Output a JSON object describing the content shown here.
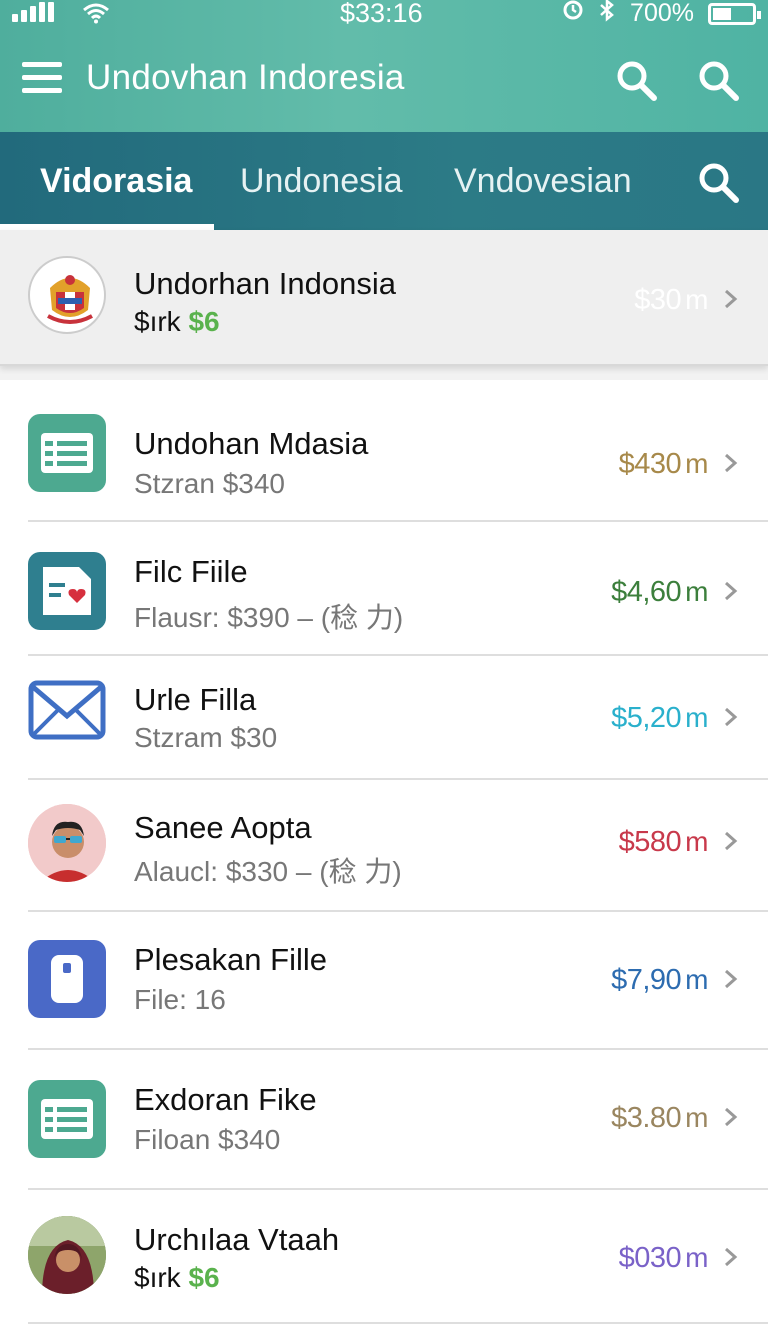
{
  "status_bar": {
    "time": "$33:16",
    "battery": "700%",
    "icons": [
      "signal-icon",
      "wifi-icon",
      "alarm-icon",
      "bluetooth-icon",
      "battery-icon"
    ]
  },
  "app_bar": {
    "title": "Undovhan Indoresia",
    "icons": [
      "menu-icon",
      "search-icon",
      "search-icon"
    ]
  },
  "tabs": [
    {
      "label": "Vidorasia",
      "active": true
    },
    {
      "label": "Undonesia",
      "active": false
    },
    {
      "label": "Vndovesian",
      "active": false
    }
  ],
  "items": [
    {
      "title": "Undorhan Indonsia",
      "sub_prefix": "$ırk",
      "sub_highlight": "$6",
      "amount": "$30",
      "unit": "m",
      "amount_color": "#ffffff",
      "icon": "emblem-icon"
    },
    {
      "title": "Undohan Mdasia",
      "sub": "Stzran $340",
      "amount": "$430",
      "unit": "m",
      "amount_color": "#a7894a",
      "icon": "list-icon"
    },
    {
      "title": "Filc Fiile",
      "sub": "Flausr: $390 – (稔 力)",
      "amount": "$4,60",
      "unit": "m",
      "amount_color": "#3c7f3c",
      "icon": "file-heart-icon"
    },
    {
      "title": "Urle Filla",
      "sub": "Stzram $30",
      "amount": "$5,20",
      "unit": "m",
      "amount_color": "#2ab0cc",
      "icon": "mail-icon"
    },
    {
      "title": "Sanee Aopta",
      "sub": "Alaucl: $330 – (稔 力)",
      "amount": "$580",
      "unit": "m",
      "amount_color": "#c8394b",
      "icon": "avatar-man-icon"
    },
    {
      "title": "Plesakan Fille",
      "sub": "File: 16",
      "amount": "$7,90",
      "unit": "m",
      "amount_color": "#2d6cb0",
      "icon": "device-icon"
    },
    {
      "title": "Exdoran Fike",
      "sub": "Filoan $340",
      "amount": "$3.80",
      "unit": "m",
      "amount_color": "#9a8660",
      "icon": "list-icon"
    },
    {
      "title": "Urchılaa Vtaah",
      "sub_prefix": "$ırk",
      "sub_highlight": "$6",
      "amount": "$030",
      "unit": "m",
      "amount_color": "#7a62c8",
      "icon": "avatar-woman-icon"
    }
  ]
}
